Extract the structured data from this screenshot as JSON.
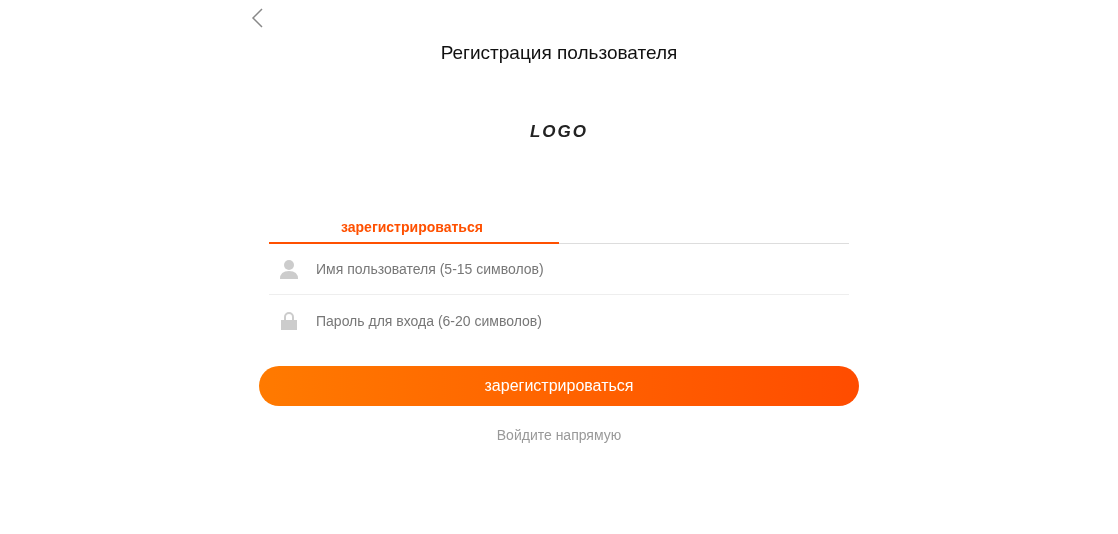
{
  "header": {
    "title": "Регистрация пользователя"
  },
  "logo": "LOGO",
  "tabs": [
    {
      "label": "зарегистрироваться",
      "selected": true
    }
  ],
  "fields": [
    {
      "kind": "user",
      "placeholder": "Имя пользователя (5-15 символов)"
    },
    {
      "kind": "password",
      "placeholder": "Пароль для входа (6-20 символов)"
    }
  ],
  "submit": "зарегистрироваться",
  "login_link": "Войдите напрямую"
}
